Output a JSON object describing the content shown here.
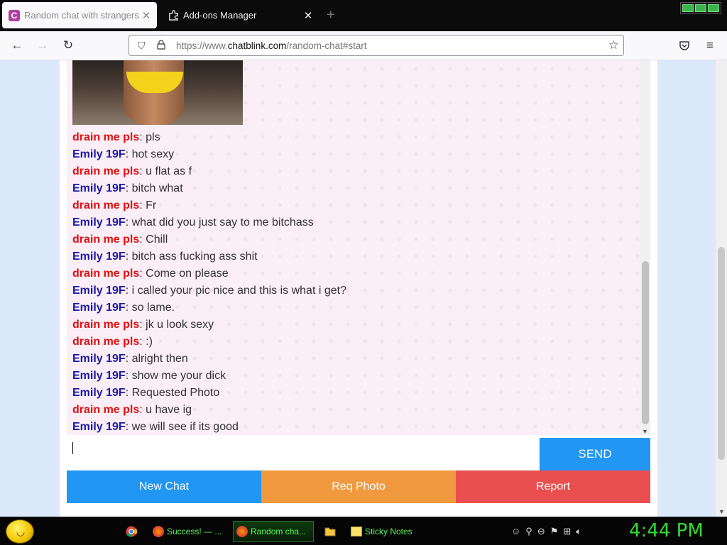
{
  "browser": {
    "tabs": [
      {
        "title": "Random chat with strangers",
        "favicon": "C",
        "active": true
      },
      {
        "title": "Add-ons Manager",
        "active": false
      }
    ],
    "new_tab": "+",
    "url_prefix": "https://www.",
    "url_domain": "chatblink.com",
    "url_path": "/random-chat#start"
  },
  "chat": {
    "messages": [
      {
        "nick": "drain me pls",
        "text": ": pls",
        "color": "red"
      },
      {
        "nick": "Emily 19F",
        "text": ": hot sexy",
        "color": "blue"
      },
      {
        "nick": "drain me pls",
        "text": ": u flat as f",
        "color": "red"
      },
      {
        "nick": "Emily 19F",
        "text": ": bitch what",
        "color": "blue"
      },
      {
        "nick": "drain me pls",
        "text": ": Fr",
        "color": "red"
      },
      {
        "nick": "Emily 19F",
        "text": ": what did you just say to me bitchass",
        "color": "blue"
      },
      {
        "nick": "drain me pls",
        "text": ": Chill",
        "color": "red"
      },
      {
        "nick": "Emily 19F",
        "text": ": bitch ass fucking ass shit",
        "color": "blue"
      },
      {
        "nick": "drain me pls",
        "text": ": Come on please",
        "color": "red"
      },
      {
        "nick": "Emily 19F",
        "text": ": i called your pic nice and this is what i get?",
        "color": "blue"
      },
      {
        "nick": "Emily 19F",
        "text": ": so lame.",
        "color": "blue"
      },
      {
        "nick": "drain me pls",
        "text": ": jk u look sexy",
        "color": "red"
      },
      {
        "nick": "drain me pls",
        "text": ": :)",
        "color": "red"
      },
      {
        "nick": "Emily 19F",
        "text": ": alright then",
        "color": "blue"
      },
      {
        "nick": "Emily 19F",
        "text": ": show me your dick",
        "color": "blue"
      },
      {
        "nick": "Emily 19F",
        "text": ": Requested Photo",
        "color": "blue"
      },
      {
        "nick": "drain me pls",
        "text": ": u have ig",
        "color": "red"
      },
      {
        "nick": "Emily 19F",
        "text": ": we will see if its good",
        "color": "blue"
      }
    ],
    "send_label": "SEND",
    "input_value": "",
    "buttons": {
      "new_chat": "New Chat",
      "req_photo": "Req Photo",
      "report": "Report"
    }
  },
  "taskbar": {
    "tasks": [
      {
        "label": "Success! — ..."
      },
      {
        "label": "Random cha..."
      },
      {
        "label": "Sticky Notes"
      }
    ],
    "clock": "4:44 PM"
  },
  "colors": {
    "send": "#2196f3",
    "req_photo": "#f0993f",
    "report": "#ea4f4f",
    "nick_red": "#e01010",
    "nick_blue": "#1a1aa6"
  }
}
